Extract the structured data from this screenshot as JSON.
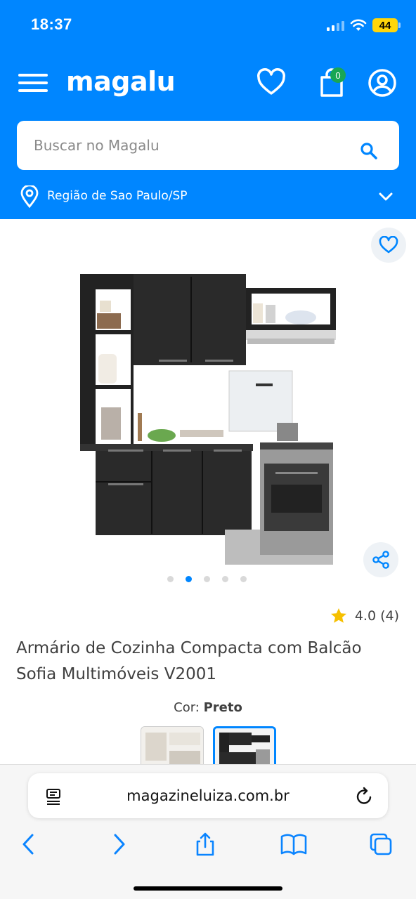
{
  "status_bar": {
    "time": "18:37",
    "battery": "44"
  },
  "header": {
    "logo": "magalu",
    "bag_count": "0",
    "icons": {
      "menu": "hamburger-menu-icon",
      "favorites": "heart-icon",
      "bag": "shopping-bag-icon",
      "account": "user-icon"
    }
  },
  "search": {
    "placeholder": "Buscar no Magalu"
  },
  "region": {
    "label": "Região de Sao Paulo/SP"
  },
  "product": {
    "title": "Armário de Cozinha Compacta com Balcão Sofia Multimóveis V2001",
    "rating": "4.0 (4)",
    "rating_value": 4.0,
    "color_label": "Cor:",
    "color_value": "Preto",
    "gallery_dots": 5,
    "gallery_active_index": 1
  },
  "browser": {
    "url": "magazineluiza.com.br"
  },
  "colors": {
    "brand_blue": "#0086ff",
    "badge_green": "#19a654",
    "star_yellow": "#f6c000",
    "battery_yellow": "#ffd60a"
  }
}
